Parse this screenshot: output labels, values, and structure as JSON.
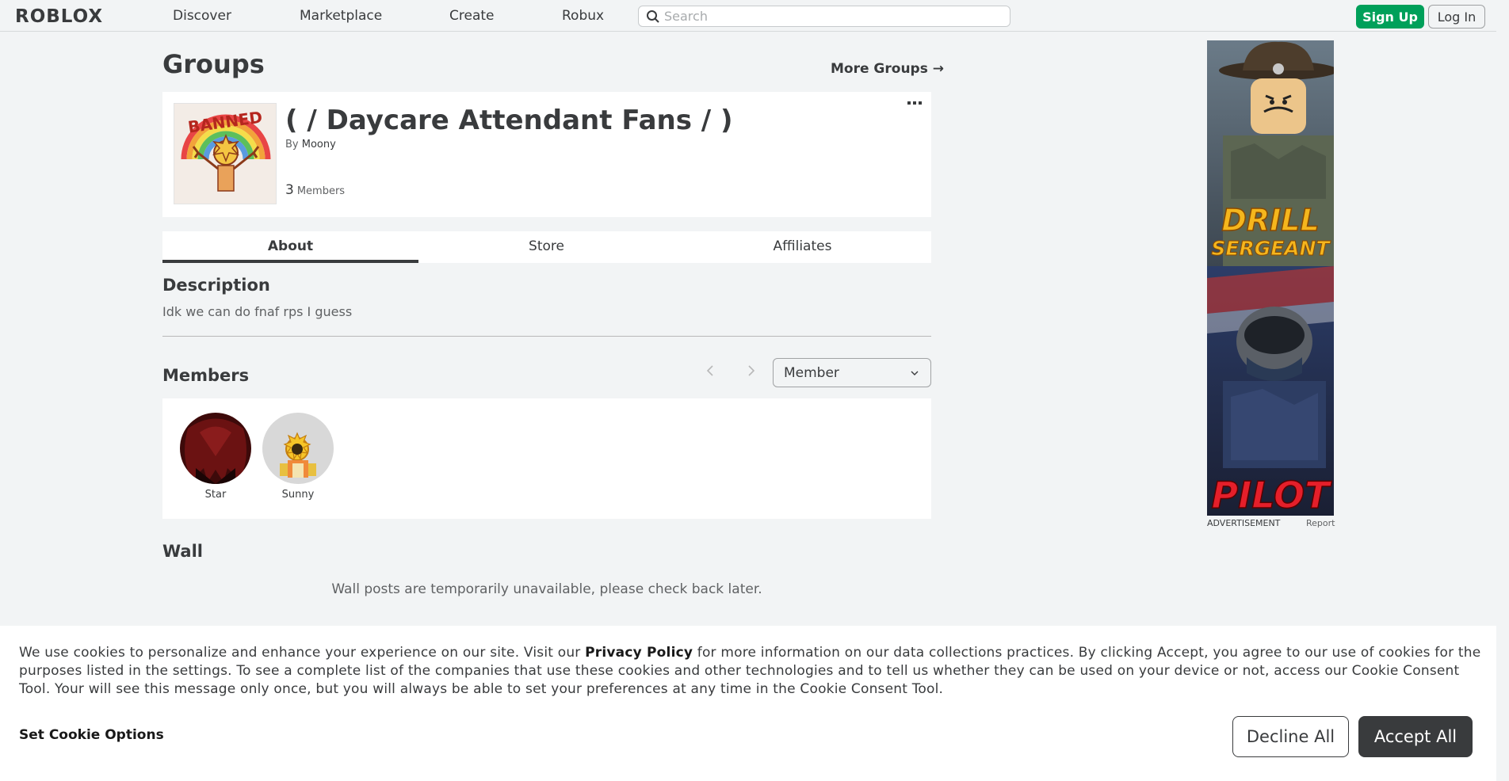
{
  "nav": {
    "logo": "ROBLOX",
    "links": [
      "Discover",
      "Marketplace",
      "Create",
      "Robux"
    ],
    "search_placeholder": "Search",
    "signup_label": "Sign Up",
    "login_label": "Log In"
  },
  "page": {
    "title": "Groups",
    "more_groups": "More Groups →"
  },
  "group": {
    "name": "( / Daycare Attendant Fans / )",
    "by_prefix": "By",
    "owner": "Moony",
    "member_count": "3",
    "members_label": "Members",
    "emblem_text": "BANNED"
  },
  "tabs": [
    {
      "label": "About",
      "active": true
    },
    {
      "label": "Store",
      "active": false
    },
    {
      "label": "Affiliates",
      "active": false
    }
  ],
  "about": {
    "description_heading": "Description",
    "description_text": "Idk we can do fnaf rps I guess"
  },
  "members_section": {
    "heading": "Members",
    "role_selected": "Member",
    "members": [
      {
        "name": "Star"
      },
      {
        "name": "Sunny"
      }
    ]
  },
  "wall": {
    "heading": "Wall",
    "message": "Wall posts are temporarily unavailable, please check back later."
  },
  "ad": {
    "line1": "DRILL",
    "line2": "SERGEANT",
    "line3": "PILOT",
    "label": "ADVERTISEMENT",
    "report": "Report"
  },
  "cookie": {
    "text_before": "We use cookies to personalize and enhance your experience on our site. Visit our ",
    "policy_link": "Privacy Policy",
    "text_after": " for more information on our data collections practices. By clicking Accept, you agree to our use of cookies for the purposes listed in the settings. To see a complete list of the companies that use these cookies and other technologies and to tell us whether they can be used on your device or not, access our Cookie Consent Tool. Your will see this message only once, but you will always be able to set your preferences at any time in the Cookie Consent Tool.",
    "options_label": "Set Cookie Options",
    "decline_label": "Decline All",
    "accept_label": "Accept All"
  },
  "colors": {
    "signup_green": "#00a05a",
    "accept_dark": "#393b3d",
    "page_bg": "#f2f4f5"
  }
}
